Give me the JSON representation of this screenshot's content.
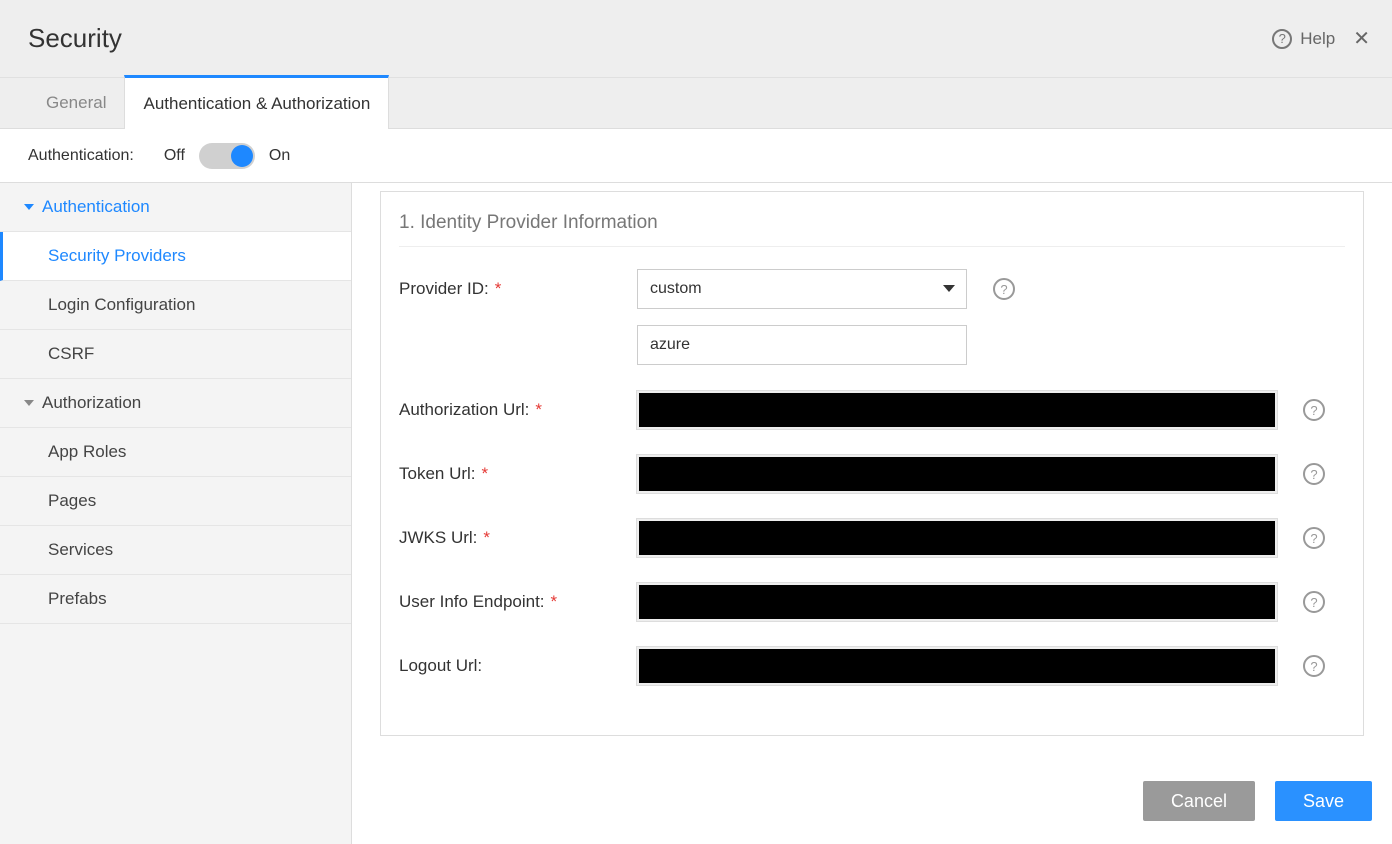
{
  "header": {
    "title": "Security",
    "help_label": "Help"
  },
  "tabs": [
    {
      "label": "General",
      "active": false
    },
    {
      "label": "Authentication & Authorization",
      "active": true
    }
  ],
  "auth_toggle": {
    "label": "Authentication:",
    "off": "Off",
    "on": "On",
    "value": "on"
  },
  "sidebar": {
    "sections": [
      {
        "label": "Authentication",
        "expanded": true,
        "active": true,
        "items": [
          {
            "label": "Security Providers",
            "active": true
          },
          {
            "label": "Login Configuration",
            "active": false
          },
          {
            "label": "CSRF",
            "active": false
          }
        ]
      },
      {
        "label": "Authorization",
        "expanded": true,
        "active": false,
        "items": [
          {
            "label": "App Roles",
            "active": false
          },
          {
            "label": "Pages",
            "active": false
          },
          {
            "label": "Services",
            "active": false
          },
          {
            "label": "Prefabs",
            "active": false
          }
        ]
      }
    ]
  },
  "panel": {
    "title": "1. Identity Provider Information",
    "fields": {
      "provider_id": {
        "label": "Provider ID:",
        "required": true,
        "select_value": "custom",
        "text_value": "azure"
      },
      "auth_url": {
        "label": "Authorization Url:",
        "required": true,
        "value": ""
      },
      "token_url": {
        "label": "Token Url:",
        "required": true,
        "value": ""
      },
      "jwks_url": {
        "label": "JWKS Url:",
        "required": true,
        "value": ""
      },
      "user_info": {
        "label": "User Info Endpoint:",
        "required": true,
        "value": ""
      },
      "logout_url": {
        "label": "Logout Url:",
        "required": false,
        "value": ""
      }
    }
  },
  "footer": {
    "cancel": "Cancel",
    "save": "Save"
  }
}
